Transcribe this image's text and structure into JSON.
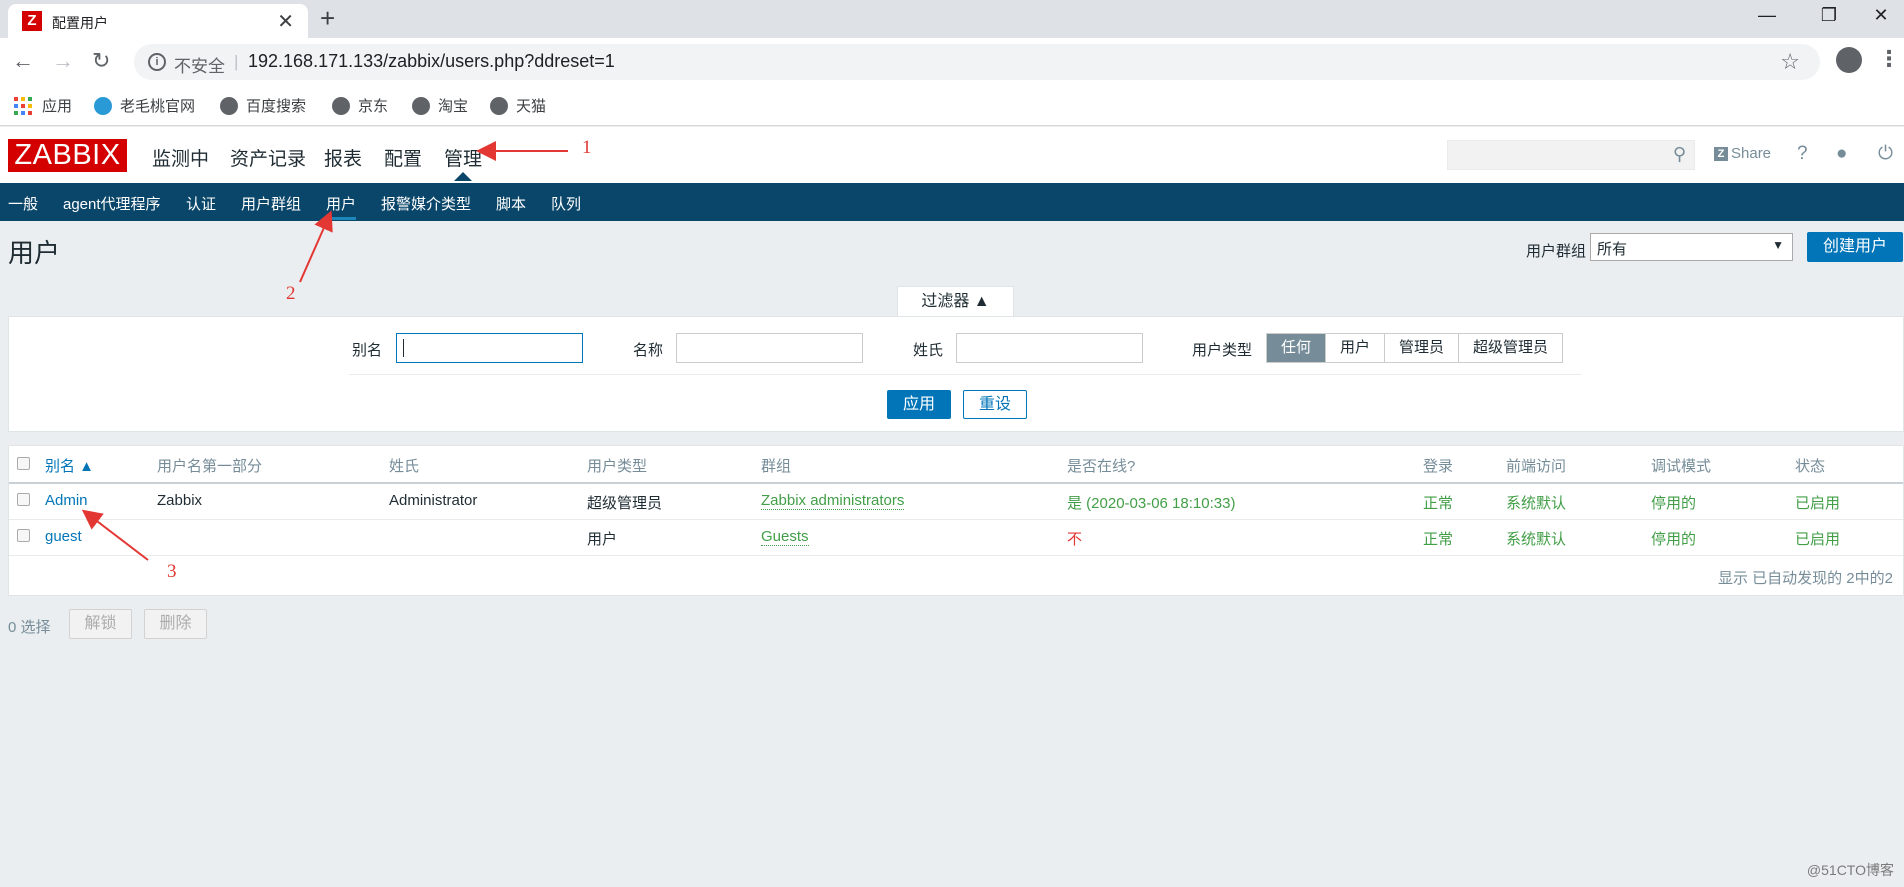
{
  "browser": {
    "tab_title": "配置用户",
    "tab_favicon": "Z",
    "insecure_label": "不安全",
    "url": "192.168.171.133/zabbix/users.php?ddreset=1",
    "bookmarks": [
      "应用",
      "老毛桃官网",
      "百度搜索",
      "京东",
      "淘宝",
      "天猫"
    ]
  },
  "header": {
    "logo": "ZABBIX",
    "menu": [
      "监测中",
      "资产记录",
      "报表",
      "配置",
      "管理"
    ],
    "share": "Share",
    "help": "?"
  },
  "subnav": [
    "一般",
    "agent代理程序",
    "认证",
    "用户群组",
    "用户",
    "报警媒介类型",
    "脚本",
    "队列"
  ],
  "page": {
    "title": "用户",
    "group_label": "用户群组",
    "group_value": "所有",
    "create_button": "创建用户"
  },
  "filter": {
    "tab_label": "过滤器 ▲",
    "alias_label": "别名",
    "name_label": "名称",
    "surname_label": "姓氏",
    "type_label": "用户类型",
    "type_options": [
      "任何",
      "用户",
      "管理员",
      "超级管理员"
    ],
    "type_selected": "任何",
    "apply": "应用",
    "reset": "重设"
  },
  "table": {
    "columns": [
      "别名 ▲",
      "用户名第一部分",
      "姓氏",
      "用户类型",
      "群组",
      "是否在线?",
      "登录",
      "前端访问",
      "调试模式",
      "状态"
    ],
    "rows": [
      {
        "alias": "Admin",
        "name": "Zabbix",
        "surname": "Administrator",
        "type": "超级管理员",
        "groups": "Zabbix administrators",
        "online": "是 (2020-03-06 18:10:33)",
        "login": "正常",
        "frontend": "系统默认",
        "debug": "停用的",
        "status": "已启用"
      },
      {
        "alias": "guest",
        "name": "",
        "surname": "",
        "type": "用户",
        "groups": "Guests",
        "online": "不",
        "login": "正常",
        "frontend": "系统默认",
        "debug": "停用的",
        "status": "已启用"
      }
    ],
    "found": "显示 已自动发现的 2中的2"
  },
  "footer": {
    "selected": "0 选择",
    "unblock": "解锁",
    "delete": "删除"
  },
  "annotations": [
    "1",
    "2",
    "3"
  ],
  "watermark": "@51CTO博客",
  "colors": {
    "brand_red": "#d40000",
    "subnav_bg": "#0a466a",
    "primary": "#0275b8",
    "ok_green": "#429e47",
    "error_red": "#e33734"
  }
}
